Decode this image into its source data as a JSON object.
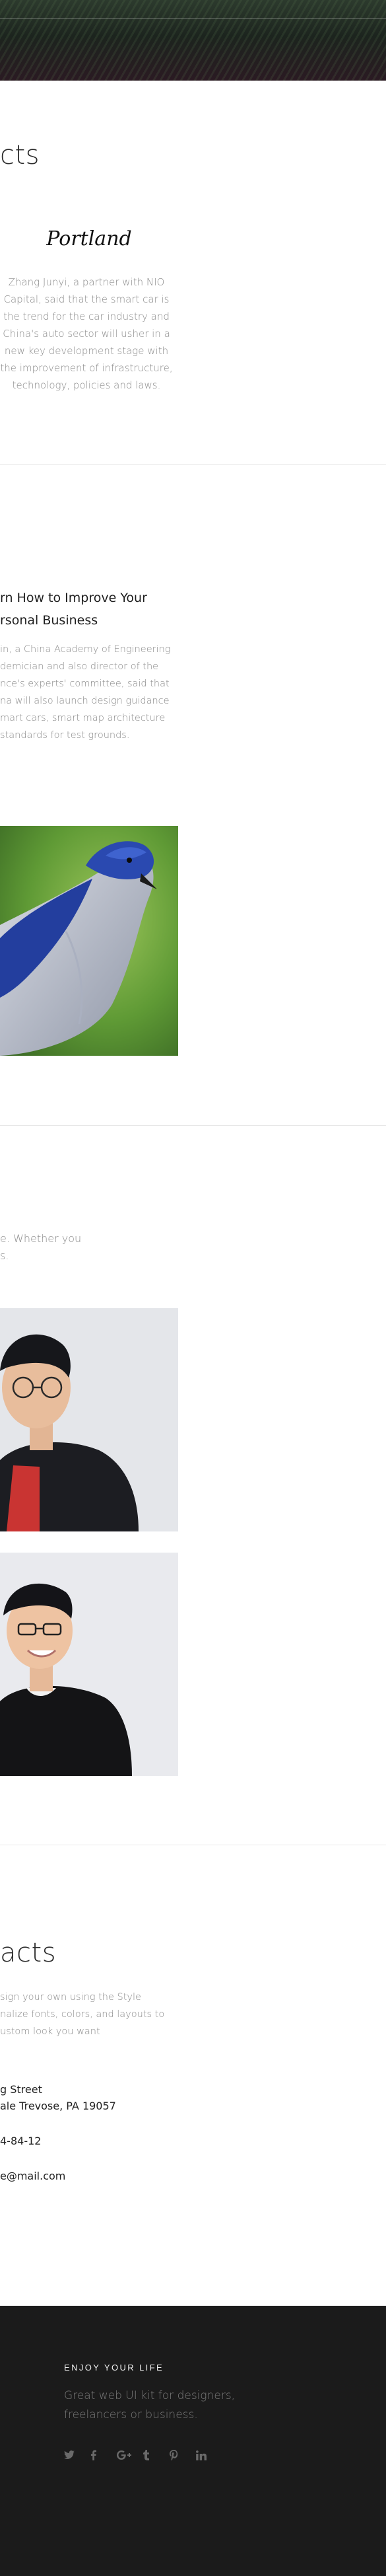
{
  "sections": {
    "products_title": "cts",
    "city": {
      "name": "Portland",
      "text_lines": [
        "Zhang Junyi, a partner with NIO",
        "Capital, said that the smart car is",
        "the trend for the car industry and",
        "China's auto sector will usher in a",
        "new key development stage with",
        "the improvement of infrastructure,",
        "technology, policies and laws."
      ]
    },
    "post": {
      "title_lines": [
        "rn How to Improve Your",
        "rsonal Business"
      ],
      "text_lines": [
        "in, a China Academy of Engineering",
        "demician and also director of the",
        "nce's experts' committee, said that",
        "na will also launch design guidance",
        "mart cars, smart map architecture",
        "standards for test grounds."
      ],
      "image_alt": "blue bird photo"
    },
    "team": {
      "intro_lines": [
        "e. Whether you",
        "s."
      ],
      "member_1_alt": "team member portrait with glasses",
      "member_2_alt": "team member portrait smiling"
    },
    "contacts": {
      "title": "acts",
      "intro_lines": [
        "sign your own using the Style",
        "nalize fonts, colors, and layouts to",
        "ustom look you want"
      ],
      "address_lines": [
        "g Street",
        "ale Trevose, PA 19057"
      ],
      "phone": "4-84-12",
      "email": "e@mail.com"
    }
  },
  "footer": {
    "tagline": "ENJOY YOUR LIFE",
    "desc_lines": [
      "Great web UI kit for designers,",
      "freelancers or business."
    ],
    "socials": [
      {
        "icon": "twitter-icon",
        "glyph": "t"
      },
      {
        "icon": "facebook-icon",
        "glyph": "f"
      },
      {
        "icon": "google-plus-icon",
        "glyph": "G+"
      },
      {
        "icon": "tumblr-icon",
        "glyph": "t"
      },
      {
        "icon": "pinterest-icon",
        "glyph": "p"
      },
      {
        "icon": "linkedin-icon",
        "glyph": "in"
      }
    ]
  },
  "colors": {
    "footer_bg": "#1b1b1b",
    "text_muted": "#8a8a8a",
    "text_dark": "#222222"
  }
}
